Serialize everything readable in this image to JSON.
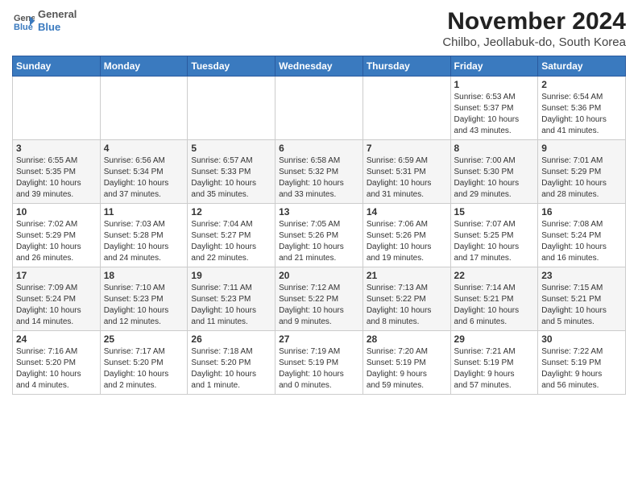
{
  "header": {
    "logo_general": "General",
    "logo_blue": "Blue",
    "title": "November 2024",
    "location": "Chilbo, Jeollabuk-do, South Korea"
  },
  "calendar": {
    "days_of_week": [
      "Sunday",
      "Monday",
      "Tuesday",
      "Wednesday",
      "Thursday",
      "Friday",
      "Saturday"
    ],
    "weeks": [
      [
        {
          "day": "",
          "info": ""
        },
        {
          "day": "",
          "info": ""
        },
        {
          "day": "",
          "info": ""
        },
        {
          "day": "",
          "info": ""
        },
        {
          "day": "",
          "info": ""
        },
        {
          "day": "1",
          "info": "Sunrise: 6:53 AM\nSunset: 5:37 PM\nDaylight: 10 hours\nand 43 minutes."
        },
        {
          "day": "2",
          "info": "Sunrise: 6:54 AM\nSunset: 5:36 PM\nDaylight: 10 hours\nand 41 minutes."
        }
      ],
      [
        {
          "day": "3",
          "info": "Sunrise: 6:55 AM\nSunset: 5:35 PM\nDaylight: 10 hours\nand 39 minutes."
        },
        {
          "day": "4",
          "info": "Sunrise: 6:56 AM\nSunset: 5:34 PM\nDaylight: 10 hours\nand 37 minutes."
        },
        {
          "day": "5",
          "info": "Sunrise: 6:57 AM\nSunset: 5:33 PM\nDaylight: 10 hours\nand 35 minutes."
        },
        {
          "day": "6",
          "info": "Sunrise: 6:58 AM\nSunset: 5:32 PM\nDaylight: 10 hours\nand 33 minutes."
        },
        {
          "day": "7",
          "info": "Sunrise: 6:59 AM\nSunset: 5:31 PM\nDaylight: 10 hours\nand 31 minutes."
        },
        {
          "day": "8",
          "info": "Sunrise: 7:00 AM\nSunset: 5:30 PM\nDaylight: 10 hours\nand 29 minutes."
        },
        {
          "day": "9",
          "info": "Sunrise: 7:01 AM\nSunset: 5:29 PM\nDaylight: 10 hours\nand 28 minutes."
        }
      ],
      [
        {
          "day": "10",
          "info": "Sunrise: 7:02 AM\nSunset: 5:29 PM\nDaylight: 10 hours\nand 26 minutes."
        },
        {
          "day": "11",
          "info": "Sunrise: 7:03 AM\nSunset: 5:28 PM\nDaylight: 10 hours\nand 24 minutes."
        },
        {
          "day": "12",
          "info": "Sunrise: 7:04 AM\nSunset: 5:27 PM\nDaylight: 10 hours\nand 22 minutes."
        },
        {
          "day": "13",
          "info": "Sunrise: 7:05 AM\nSunset: 5:26 PM\nDaylight: 10 hours\nand 21 minutes."
        },
        {
          "day": "14",
          "info": "Sunrise: 7:06 AM\nSunset: 5:26 PM\nDaylight: 10 hours\nand 19 minutes."
        },
        {
          "day": "15",
          "info": "Sunrise: 7:07 AM\nSunset: 5:25 PM\nDaylight: 10 hours\nand 17 minutes."
        },
        {
          "day": "16",
          "info": "Sunrise: 7:08 AM\nSunset: 5:24 PM\nDaylight: 10 hours\nand 16 minutes."
        }
      ],
      [
        {
          "day": "17",
          "info": "Sunrise: 7:09 AM\nSunset: 5:24 PM\nDaylight: 10 hours\nand 14 minutes."
        },
        {
          "day": "18",
          "info": "Sunrise: 7:10 AM\nSunset: 5:23 PM\nDaylight: 10 hours\nand 12 minutes."
        },
        {
          "day": "19",
          "info": "Sunrise: 7:11 AM\nSunset: 5:23 PM\nDaylight: 10 hours\nand 11 minutes."
        },
        {
          "day": "20",
          "info": "Sunrise: 7:12 AM\nSunset: 5:22 PM\nDaylight: 10 hours\nand 9 minutes."
        },
        {
          "day": "21",
          "info": "Sunrise: 7:13 AM\nSunset: 5:22 PM\nDaylight: 10 hours\nand 8 minutes."
        },
        {
          "day": "22",
          "info": "Sunrise: 7:14 AM\nSunset: 5:21 PM\nDaylight: 10 hours\nand 6 minutes."
        },
        {
          "day": "23",
          "info": "Sunrise: 7:15 AM\nSunset: 5:21 PM\nDaylight: 10 hours\nand 5 minutes."
        }
      ],
      [
        {
          "day": "24",
          "info": "Sunrise: 7:16 AM\nSunset: 5:20 PM\nDaylight: 10 hours\nand 4 minutes."
        },
        {
          "day": "25",
          "info": "Sunrise: 7:17 AM\nSunset: 5:20 PM\nDaylight: 10 hours\nand 2 minutes."
        },
        {
          "day": "26",
          "info": "Sunrise: 7:18 AM\nSunset: 5:20 PM\nDaylight: 10 hours\nand 1 minute."
        },
        {
          "day": "27",
          "info": "Sunrise: 7:19 AM\nSunset: 5:19 PM\nDaylight: 10 hours\nand 0 minutes."
        },
        {
          "day": "28",
          "info": "Sunrise: 7:20 AM\nSunset: 5:19 PM\nDaylight: 9 hours\nand 59 minutes."
        },
        {
          "day": "29",
          "info": "Sunrise: 7:21 AM\nSunset: 5:19 PM\nDaylight: 9 hours\nand 57 minutes."
        },
        {
          "day": "30",
          "info": "Sunrise: 7:22 AM\nSunset: 5:19 PM\nDaylight: 9 hours\nand 56 minutes."
        }
      ]
    ]
  }
}
